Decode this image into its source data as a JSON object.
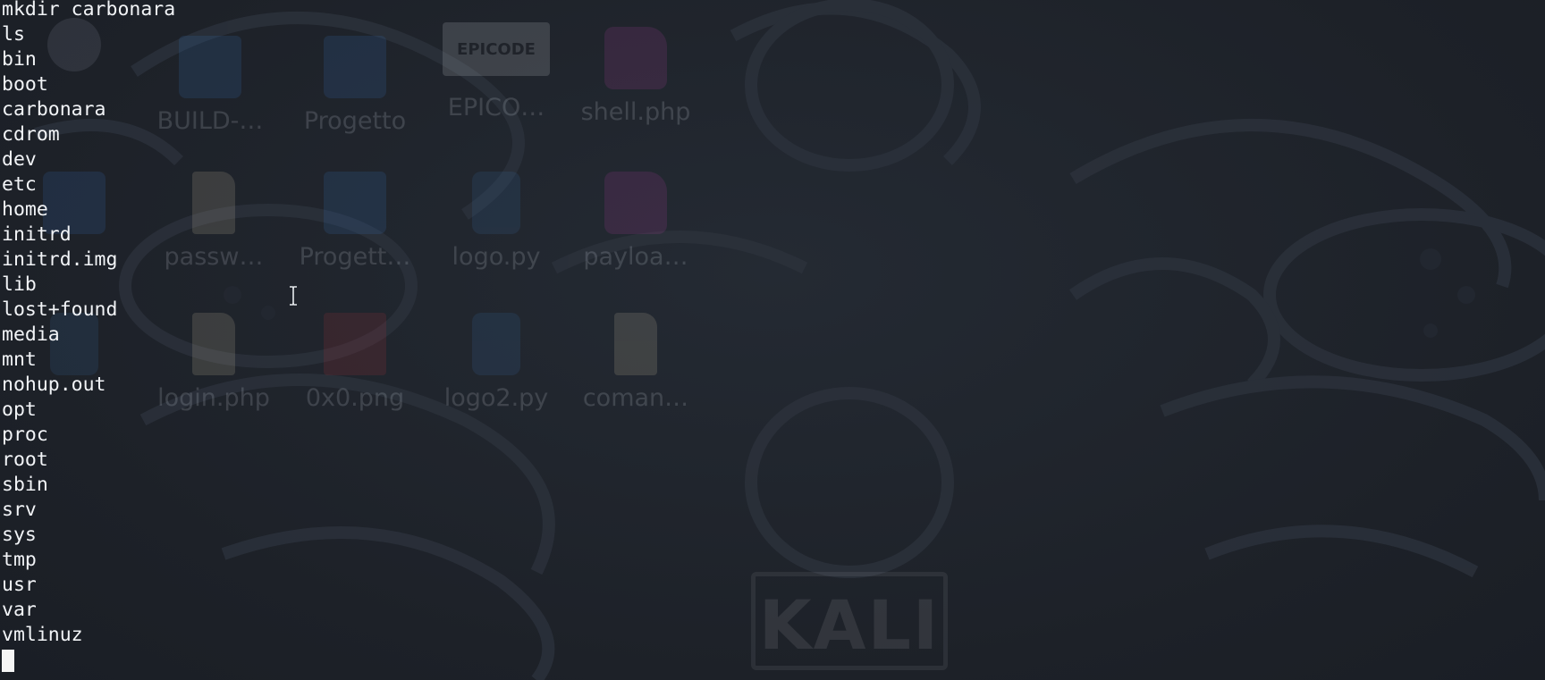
{
  "terminal": {
    "command": "mkdir carbonara",
    "lines": [
      "ls",
      "bin",
      "boot",
      "carbonara",
      "cdrom",
      "dev",
      "etc",
      "home",
      "initrd",
      "initrd.img",
      "lib",
      "lost+found",
      "media",
      "mnt",
      "nohup.out",
      "opt",
      "proc",
      "root",
      "sbin",
      "srv",
      "sys",
      "tmp",
      "usr",
      "var",
      "vmlinuz"
    ]
  },
  "desktop": {
    "icons": [
      {
        "label": "BUILD-…",
        "icon": "folder-icon"
      },
      {
        "label": "Progetto",
        "icon": "folder-icon"
      },
      {
        "label": "EPICO…",
        "icon": "epicode-logo-icon",
        "logo_text": "EPICODE"
      },
      {
        "label": "shell.php",
        "icon": "php-file-icon"
      },
      {
        "label": "passw…",
        "icon": "text-file-icon"
      },
      {
        "label": "Progett…",
        "icon": "folder-icon"
      },
      {
        "label": "logo.py",
        "icon": "python-file-icon"
      },
      {
        "label": "payloa…",
        "icon": "php-file-icon"
      },
      {
        "label": "login.php",
        "icon": "text-file-icon"
      },
      {
        "label": "0x0.png",
        "icon": "image-file-icon"
      },
      {
        "label": "logo2.py",
        "icon": "python-file-icon"
      },
      {
        "label": "coman…",
        "icon": "text-file-icon"
      }
    ],
    "wallpaper_logo": "KALI"
  },
  "colors": {
    "background": "#1e222a",
    "text": "#f2f4f7"
  }
}
